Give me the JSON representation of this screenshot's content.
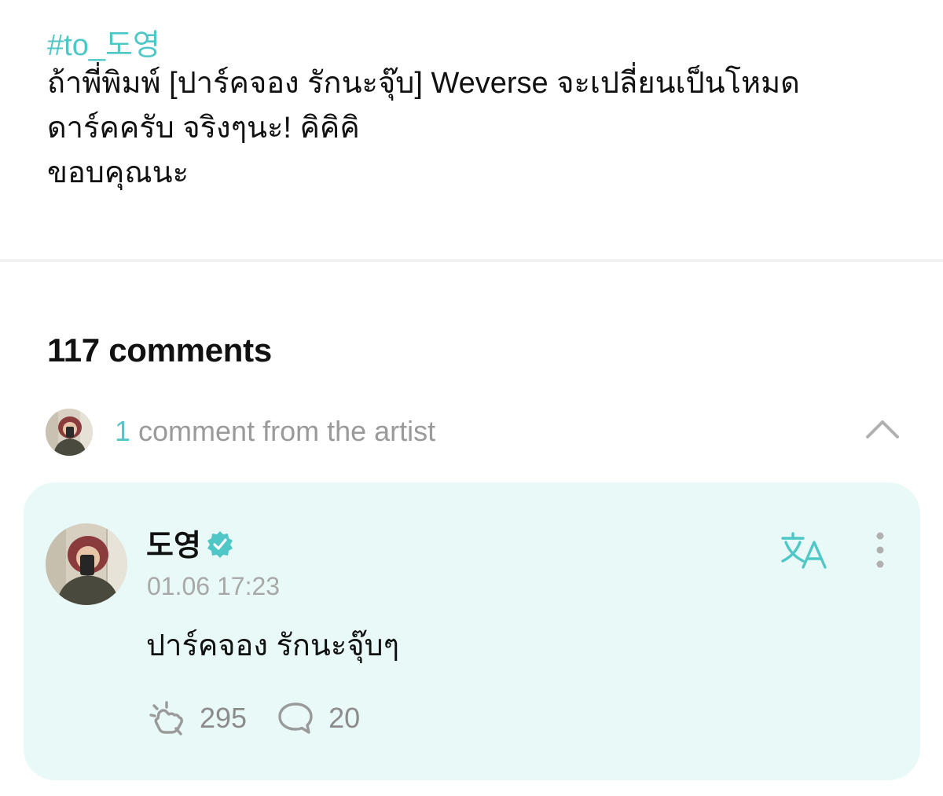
{
  "post": {
    "hashtag": "#to_도영",
    "body_lines": [
      "ถ้าพี่พิมพ์ [ปาร์คจอง รักนะจุ๊บ] Weverse จะเปลี่ยนเป็นโหมด",
      "ดาร์คครับ จริงๆนะ! คิคิคิ",
      "ขอบคุณนะ"
    ]
  },
  "comments": {
    "count_label": "117 comments",
    "artist_summary": {
      "count": "1",
      "label": " comment from the artist"
    }
  },
  "artist_comment": {
    "author": "도영",
    "timestamp": "01.06 17:23",
    "text": "ปาร์คจอง รักนะจุ๊บๆ",
    "like_count": "295",
    "reply_count": "20"
  },
  "icons": {
    "verified": "verified-badge-icon",
    "translate": "translate-icon",
    "more": "more-vertical-icon",
    "collapse": "chevron-up-icon",
    "like": "like-icon",
    "reply": "reply-bubble-icon"
  },
  "colors": {
    "accent": "#4fc7c7",
    "card_background": "#e9f9f8",
    "muted_text": "#9a9a9a"
  }
}
